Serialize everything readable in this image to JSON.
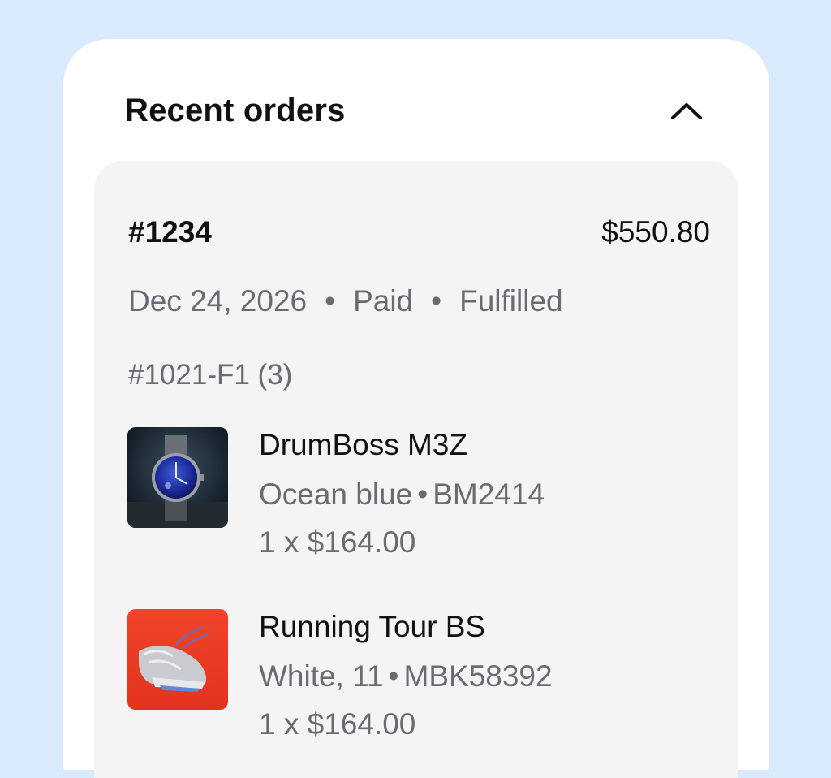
{
  "header": {
    "title": "Recent orders",
    "collapse_icon": "chevron-up-icon"
  },
  "order": {
    "id": "#1234",
    "total": "$550.80",
    "date": "Dec 24, 2026",
    "separator": "•",
    "payment_status": "Paid",
    "fulfillment_status": "Fulfilled",
    "fulfillment_ref": "#1021-F1 (3)",
    "items": [
      {
        "name": "DrumBoss M3Z",
        "variant": "Ocean blue",
        "sku": "BM2414",
        "quantity_price": "1 x $164.00",
        "thumbnail": "watch-image"
      },
      {
        "name": "Running Tour BS",
        "variant": "White, 11",
        "sku": "MBK58392",
        "quantity_price": "1 x $164.00",
        "thumbnail": "sneaker-image"
      }
    ]
  },
  "colors": {
    "background": "#d8eafc",
    "card": "#ffffff",
    "panel": "#f4f4f4",
    "primary_text": "#111111",
    "secondary_text": "#6a6a72"
  }
}
